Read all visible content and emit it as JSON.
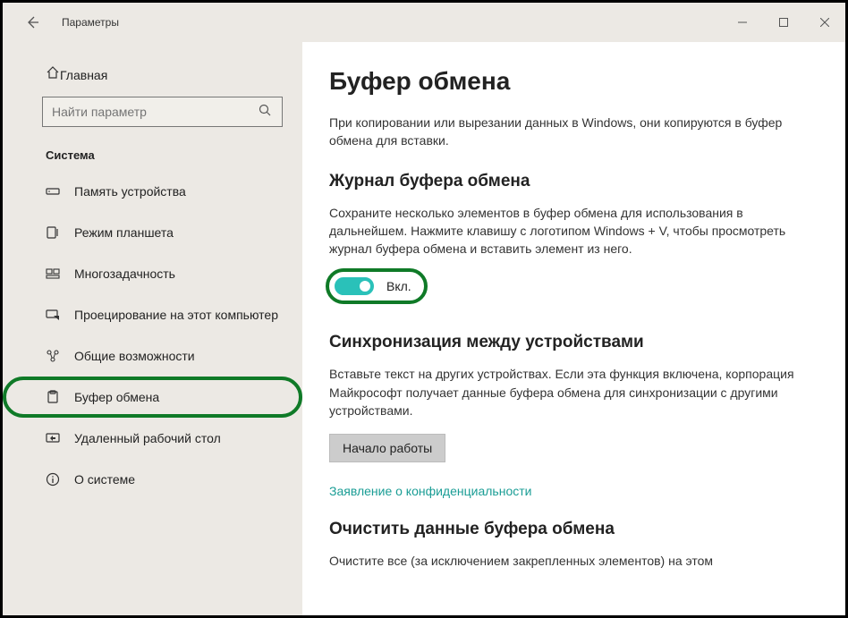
{
  "window": {
    "title": "Параметры"
  },
  "sidebar": {
    "home": "Главная",
    "search_placeholder": "Найти параметр",
    "category": "Система",
    "items": [
      {
        "label": "Память устройства"
      },
      {
        "label": "Режим планшета"
      },
      {
        "label": "Многозадачность"
      },
      {
        "label": "Проецирование на этот компьютер"
      },
      {
        "label": "Общие возможности"
      },
      {
        "label": "Буфер обмена"
      },
      {
        "label": "Удаленный рабочий стол"
      },
      {
        "label": "О системе"
      }
    ]
  },
  "content": {
    "title": "Буфер обмена",
    "intro": "При копировании или вырезании данных в Windows, они копируются в буфер обмена для вставки.",
    "history_heading": "Журнал буфера обмена",
    "history_desc": "Сохраните несколько элементов в буфер обмена для использования в дальнейшем. Нажмите клавишу с логотипом Windows + V, чтобы просмотреть журнал буфера обмена и вставить элемент из него.",
    "toggle_label": "Вкл.",
    "sync_heading": "Синхронизация между устройствами",
    "sync_desc": "Вставьте текст на других устройствах. Если эта функция включена, корпорация Майкрософт получает данные буфера обмена для синхронизации с другими устройствами.",
    "sync_button": "Начало работы",
    "privacy_link": "Заявление о конфиденциальности",
    "clear_heading": "Очистить данные буфера обмена",
    "clear_desc": "Очистите все (за исключением закрепленных элементов) на этом"
  }
}
